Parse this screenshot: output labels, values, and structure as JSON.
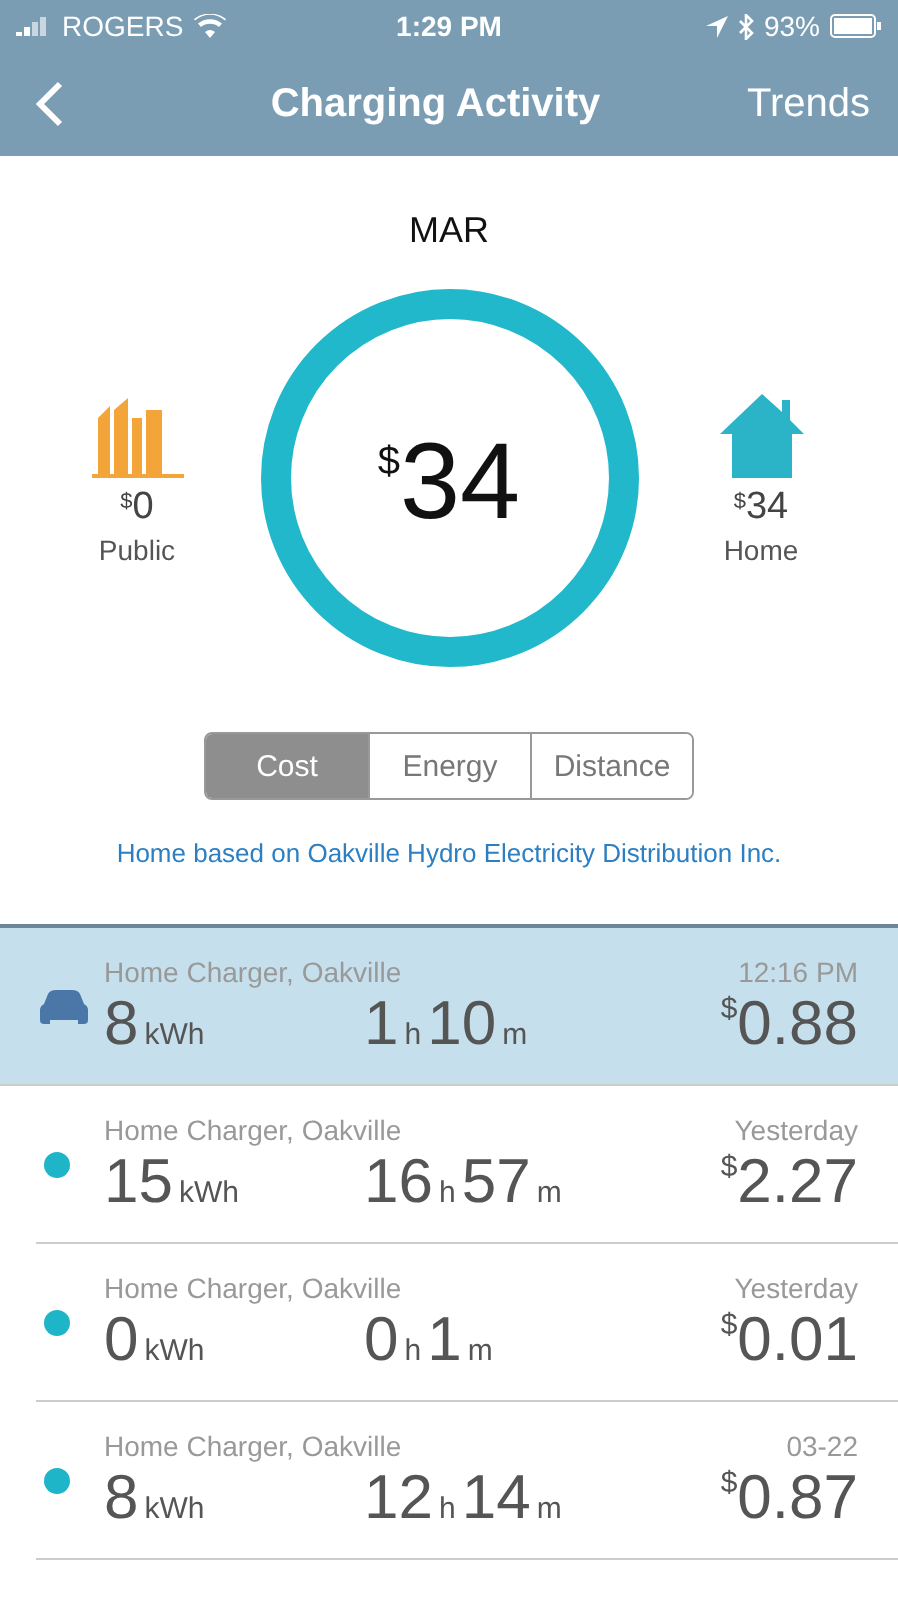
{
  "status_bar": {
    "carrier": "ROGERS",
    "time": "1:29 PM",
    "battery": "93%"
  },
  "nav": {
    "title": "Charging Activity",
    "action": "Trends"
  },
  "summary": {
    "month": "MAR",
    "total": {
      "currency": "$",
      "amount": "34"
    },
    "sides": [
      {
        "kind": "public",
        "currency": "$",
        "amount": "0",
        "label": "Public"
      },
      {
        "kind": "home",
        "currency": "$",
        "amount": "34",
        "label": "Home"
      }
    ]
  },
  "segments": [
    {
      "label": "Cost",
      "selected": true
    },
    {
      "label": "Energy",
      "selected": false
    },
    {
      "label": "Distance",
      "selected": false
    }
  ],
  "note": "Home based on Oakville Hydro Electricity Distribution Inc.",
  "sessions": [
    {
      "selected": true,
      "location": "Home Charger, Oakville",
      "when": "12:16 PM",
      "energy": "8",
      "energy_unit": "kWh",
      "hours": "1",
      "hours_unit": "h",
      "minutes": "10",
      "minutes_unit": "m",
      "currency": "$",
      "cost": "0.88"
    },
    {
      "selected": false,
      "location": "Home Charger, Oakville",
      "when": "Yesterday",
      "energy": "15",
      "energy_unit": "kWh",
      "hours": "16",
      "hours_unit": "h",
      "minutes": "57",
      "minutes_unit": "m",
      "currency": "$",
      "cost": "2.27"
    },
    {
      "selected": false,
      "location": "Home Charger, Oakville",
      "when": "Yesterday",
      "energy": "0",
      "energy_unit": "kWh",
      "hours": "0",
      "hours_unit": "h",
      "minutes": "1",
      "minutes_unit": "m",
      "currency": "$",
      "cost": "0.01"
    },
    {
      "selected": false,
      "location": "Home Charger, Oakville",
      "when": "03-22",
      "energy": "8",
      "energy_unit": "kWh",
      "hours": "12",
      "hours_unit": "h",
      "minutes": "14",
      "minutes_unit": "m",
      "currency": "$",
      "cost": "0.87"
    }
  ]
}
